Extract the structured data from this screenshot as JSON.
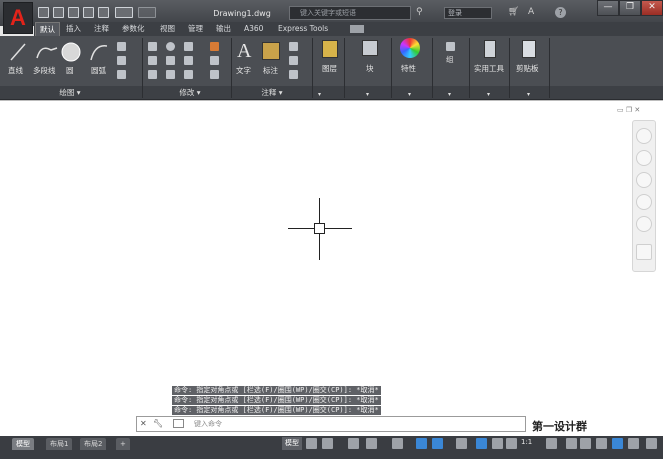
{
  "titlebar": {
    "document_title": "Drawing1.dwg",
    "search_placeholder": "键入关键字或短语",
    "signin_label": "登录",
    "minimize": "—",
    "maximize": "❐",
    "close": "✕"
  },
  "app_logo": "A",
  "tabs": [
    {
      "label": "默认",
      "active": true
    },
    {
      "label": "插入"
    },
    {
      "label": "注释"
    },
    {
      "label": "参数化"
    },
    {
      "label": "视图"
    },
    {
      "label": "管理"
    },
    {
      "label": "输出"
    },
    {
      "label": "A360"
    },
    {
      "label": "Express Tools"
    }
  ],
  "ribbon": {
    "draw_buttons": [
      "直线",
      "多段线",
      "圆",
      "圆弧"
    ],
    "text_button": "文字",
    "dim_button": "标注",
    "layers_button": "图层",
    "block_button": "块",
    "properties_button": "特性",
    "group_button": "组",
    "utilities_button": "实用工具",
    "clipboard_button": "剪贴板",
    "panels": [
      "绘图 ▾",
      "修改 ▾",
      "注释 ▾"
    ]
  },
  "command_history": [
    "命令: 指定对角点或 [栏选(F)/圈围(WP)/圈交(CP)]: *取消*",
    "命令: 指定对角点或 [栏选(F)/圈围(WP)/圈交(CP)]: *取消*",
    "命令: 指定对角点或 [栏选(F)/圈围(WP)/圈交(CP)]: *取消*"
  ],
  "command_input_placeholder": "键入命令",
  "layout_tabs": [
    "模型",
    "布局1",
    "布局2",
    "+"
  ],
  "status": {
    "model_label": "模型",
    "scale": "1:1"
  },
  "watermark": "第一设计群",
  "colors": {
    "accent": "#e2231a",
    "ribbon": "#4b4e53"
  }
}
